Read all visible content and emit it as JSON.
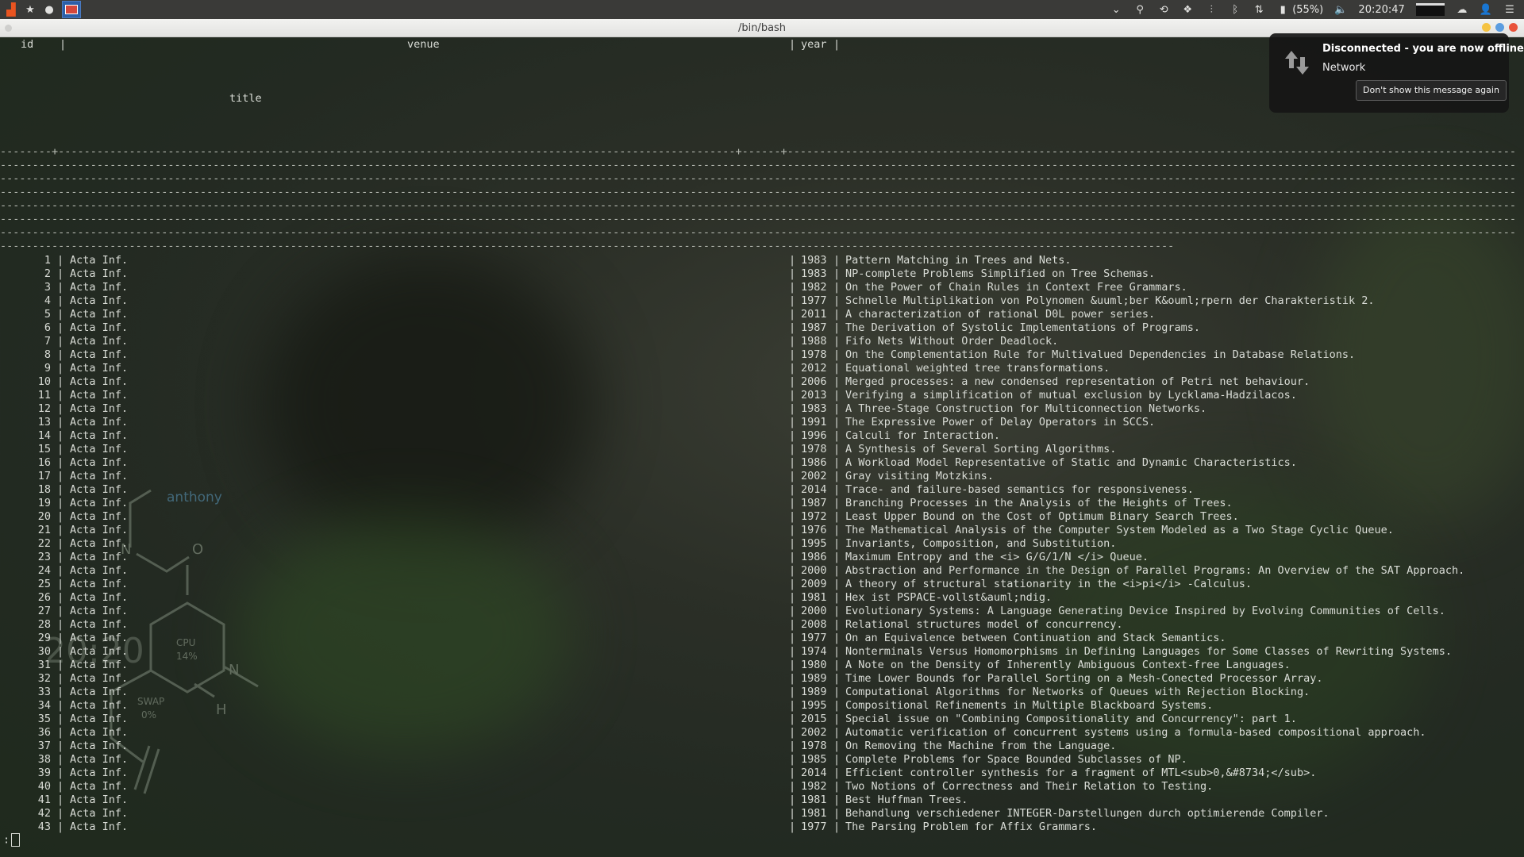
{
  "panel": {
    "clock": "20:20:47",
    "battery": "(55%)",
    "icons": [
      "ubuntu-logo-icon",
      "star-icon",
      "circle-icon",
      "terminal-app-icon",
      "chevron-down-icon",
      "search-icon",
      "history-icon",
      "dropbox-icon",
      "network-activity-icon",
      "bluetooth-icon",
      "network-transfer-icon",
      "battery-icon",
      "volume-icon",
      "display-icon",
      "cloud-icon",
      "user-icon",
      "menu-icon"
    ]
  },
  "window": {
    "title": "/bin/bash"
  },
  "table": {
    "header": {
      "id": "id",
      "sep": "|",
      "venue": "venue",
      "year": "year",
      "title": "title"
    },
    "rows": [
      {
        "id": "1",
        "venue": "Acta Inf.",
        "year": "1983",
        "title": "Pattern Matching in Trees and Nets."
      },
      {
        "id": "2",
        "venue": "Acta Inf.",
        "year": "1983",
        "title": "NP-complete Problems Simplified on Tree Schemas."
      },
      {
        "id": "3",
        "venue": "Acta Inf.",
        "year": "1982",
        "title": "On the Power of Chain Rules in Context Free Grammars."
      },
      {
        "id": "4",
        "venue": "Acta Inf.",
        "year": "1977",
        "title": "Schnelle Multiplikation von Polynomen &uuml;ber K&ouml;rpern der Charakteristik 2."
      },
      {
        "id": "5",
        "venue": "Acta Inf.",
        "year": "2011",
        "title": "A characterization of rational D0L power series."
      },
      {
        "id": "6",
        "venue": "Acta Inf.",
        "year": "1987",
        "title": "The Derivation of Systolic Implementations of Programs."
      },
      {
        "id": "7",
        "venue": "Acta Inf.",
        "year": "1988",
        "title": "Fifo Nets Without Order Deadlock."
      },
      {
        "id": "8",
        "venue": "Acta Inf.",
        "year": "1978",
        "title": "On the Complementation Rule for Multivalued Dependencies in Database Relations."
      },
      {
        "id": "9",
        "venue": "Acta Inf.",
        "year": "2012",
        "title": "Equational weighted tree transformations."
      },
      {
        "id": "10",
        "venue": "Acta Inf.",
        "year": "2006",
        "title": "Merged processes: a new condensed representation of Petri net behaviour."
      },
      {
        "id": "11",
        "venue": "Acta Inf.",
        "year": "2013",
        "title": "Verifying a simplification of mutual exclusion by Lycklama-Hadzilacos."
      },
      {
        "id": "12",
        "venue": "Acta Inf.",
        "year": "1983",
        "title": "A Three-Stage Construction for Multiconnection Networks."
      },
      {
        "id": "13",
        "venue": "Acta Inf.",
        "year": "1991",
        "title": "The Expressive Power of Delay Operators in SCCS."
      },
      {
        "id": "14",
        "venue": "Acta Inf.",
        "year": "1996",
        "title": "Calculi for Interaction."
      },
      {
        "id": "15",
        "venue": "Acta Inf.",
        "year": "1978",
        "title": "A Synthesis of Several Sorting Algorithms."
      },
      {
        "id": "16",
        "venue": "Acta Inf.",
        "year": "1986",
        "title": "A Workload Model Representative of Static and Dynamic Characteristics."
      },
      {
        "id": "17",
        "venue": "Acta Inf.",
        "year": "2002",
        "title": "Gray visiting Motzkins."
      },
      {
        "id": "18",
        "venue": "Acta Inf.",
        "year": "2014",
        "title": "Trace- and failure-based semantics for responsiveness."
      },
      {
        "id": "19",
        "venue": "Acta Inf.",
        "year": "1987",
        "title": "Branching Processes in the Analysis of the Heights of Trees."
      },
      {
        "id": "20",
        "venue": "Acta Inf.",
        "year": "1972",
        "title": "Least Upper Bound on the Cost of Optimum Binary Search Trees."
      },
      {
        "id": "21",
        "venue": "Acta Inf.",
        "year": "1976",
        "title": "The Mathematical Analysis of the Computer System Modeled as a Two Stage Cyclic Queue."
      },
      {
        "id": "22",
        "venue": "Acta Inf.",
        "year": "1995",
        "title": "Invariants, Composition, and Substitution."
      },
      {
        "id": "23",
        "venue": "Acta Inf.",
        "year": "1986",
        "title": "Maximum Entropy and the <i> G/G/1/N </i> Queue."
      },
      {
        "id": "24",
        "venue": "Acta Inf.",
        "year": "2000",
        "title": "Abstraction and Performance in the Design of Parallel Programs: An Overview of the SAT Approach."
      },
      {
        "id": "25",
        "venue": "Acta Inf.",
        "year": "2009",
        "title": "A theory of structural stationarity in the <i>pi</i> -Calculus."
      },
      {
        "id": "26",
        "venue": "Acta Inf.",
        "year": "1981",
        "title": "Hex ist PSPACE-vollst&auml;ndig."
      },
      {
        "id": "27",
        "venue": "Acta Inf.",
        "year": "2000",
        "title": "Evolutionary Systems: A Language Generating Device Inspired by Evolving Communities of Cells."
      },
      {
        "id": "28",
        "venue": "Acta Inf.",
        "year": "2008",
        "title": "Relational structures model of concurrency."
      },
      {
        "id": "29",
        "venue": "Acta Inf.",
        "year": "1977",
        "title": "On an Equivalence between Continuation and Stack Semantics."
      },
      {
        "id": "30",
        "venue": "Acta Inf.",
        "year": "1974",
        "title": "Nonterminals Versus Homomorphisms in Defining Languages for Some Classes of Rewriting Systems."
      },
      {
        "id": "31",
        "venue": "Acta Inf.",
        "year": "1980",
        "title": "A Note on the Density of Inherently Ambiguous Context-free Languages."
      },
      {
        "id": "32",
        "venue": "Acta Inf.",
        "year": "1989",
        "title": "Time Lower Bounds for Parallel Sorting on a Mesh-Conected Processor Array."
      },
      {
        "id": "33",
        "venue": "Acta Inf.",
        "year": "1989",
        "title": "Computational Algorithms for Networks of Queues with Rejection Blocking."
      },
      {
        "id": "34",
        "venue": "Acta Inf.",
        "year": "1995",
        "title": "Compositional Refinements in Multiple Blackboard Systems."
      },
      {
        "id": "35",
        "venue": "Acta Inf.",
        "year": "2015",
        "title": "Special issue on \"Combining Compositionality and Concurrency\": part 1."
      },
      {
        "id": "36",
        "venue": "Acta Inf.",
        "year": "2002",
        "title": "Automatic verification of concurrent systems using a formula-based compositional approach."
      },
      {
        "id": "37",
        "venue": "Acta Inf.",
        "year": "1978",
        "title": "On Removing the Machine from the Language."
      },
      {
        "id": "38",
        "venue": "Acta Inf.",
        "year": "1985",
        "title": "Complete Problems for Space Bounded Subclasses of NP."
      },
      {
        "id": "39",
        "venue": "Acta Inf.",
        "year": "2014",
        "title": "Efficient controller synthesis for a fragment of MTL<sub>0,&#8734;</sub>."
      },
      {
        "id": "40",
        "venue": "Acta Inf.",
        "year": "1982",
        "title": "Two Notions of Correctness and Their Relation to Testing."
      },
      {
        "id": "41",
        "venue": "Acta Inf.",
        "year": "1981",
        "title": "Best Huffman Trees."
      },
      {
        "id": "42",
        "venue": "Acta Inf.",
        "year": "1981",
        "title": "Behandlung verschiedener INTEGER-Darstellungen durch optimierende Compiler."
      },
      {
        "id": "43",
        "venue": "Acta Inf.",
        "year": "1977",
        "title": "The Parsing Problem for Affix Grammars."
      }
    ]
  },
  "prompt": {
    "text": ":"
  },
  "desktop_widget": {
    "username": "anthony",
    "clock": "20:20",
    "cpu_label": "CPU",
    "cpu_value": "14%",
    "swap_label": "SWAP",
    "swap_value": "0%",
    "atoms": [
      "N",
      "O",
      "N",
      "H"
    ]
  },
  "notification": {
    "title": "Disconnected - you are now offline",
    "body": "Network",
    "button": "Don't show this message again"
  }
}
